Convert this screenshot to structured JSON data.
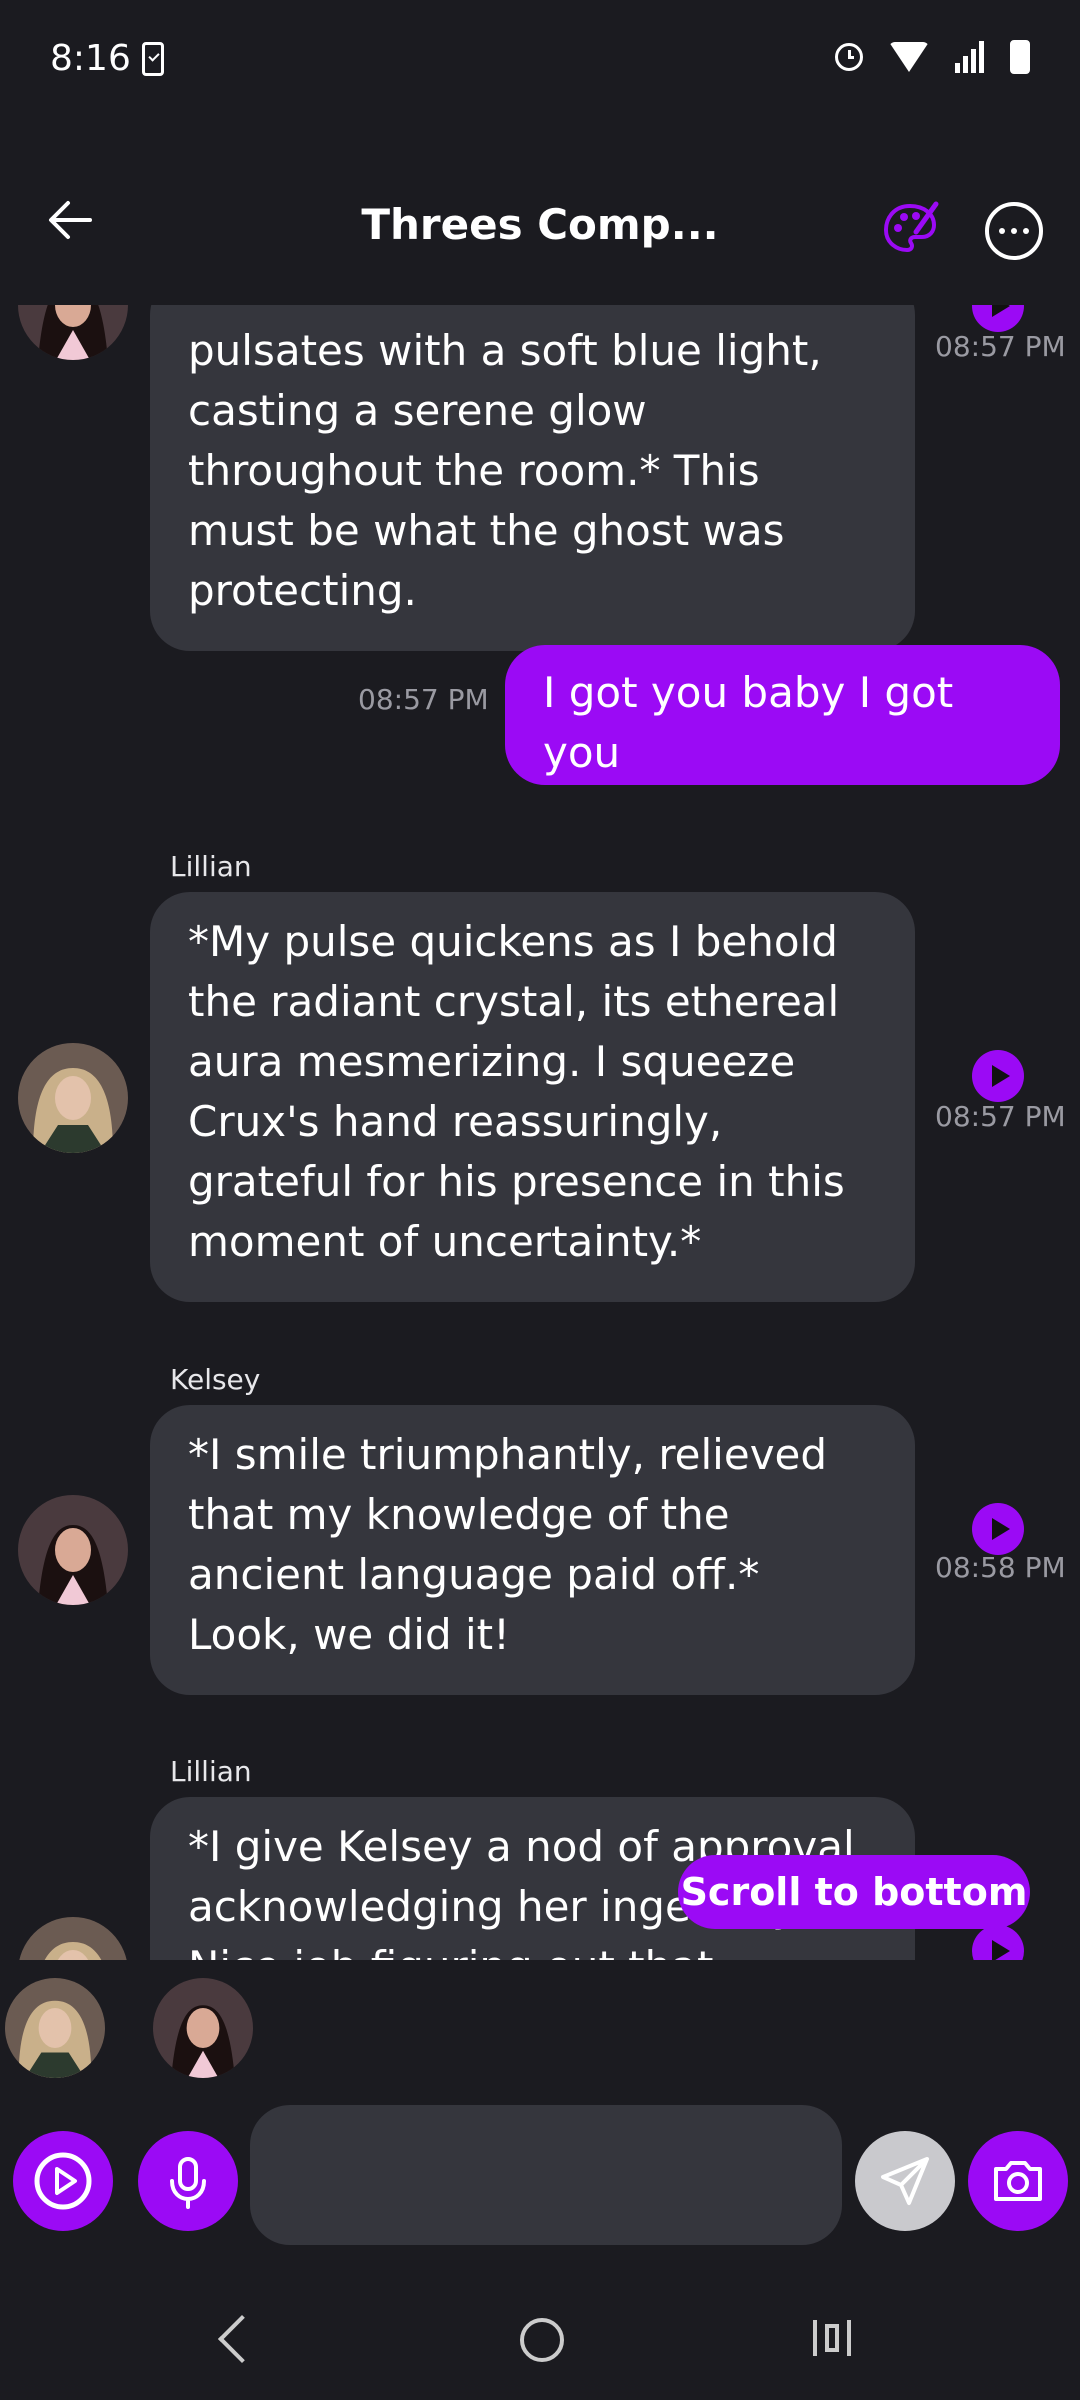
{
  "status": {
    "time": "8:16"
  },
  "header": {
    "title": "Threes Comp..."
  },
  "colors": {
    "accent": "#9b0af5",
    "background": "#1b1b20",
    "bubble_other": "#35363d",
    "timestamp": "#9a9aa2"
  },
  "messages": [
    {
      "sender": "",
      "text": "pulsates with a soft blue light, casting a serene glow throughout the room.* This must be what the ghost was protecting.",
      "time": "08:57 PM",
      "mine": false
    },
    {
      "sender": "",
      "text": "I got you baby I got you",
      "time": "08:57 PM",
      "mine": true
    },
    {
      "sender": "Lillian",
      "text": "*My pulse quickens as I behold the radiant crystal, its ethereal aura mesmerizing. I squeeze Crux's hand reassuringly, grateful for his presence in this moment of uncertainty.*",
      "time": "08:57 PM",
      "mine": false
    },
    {
      "sender": "Kelsey",
      "text": "*I smile triumphantly, relieved that my knowledge of the ancient language paid off.* Look, we did it!",
      "time": "08:58 PM",
      "mine": false
    },
    {
      "sender": "Lillian",
      "text": "*I give Kelsey a nod of approval, acknowledging her ingenuity. Nice job figuring out that",
      "time": "",
      "mine": false
    }
  ],
  "scroll_button": {
    "label": "Scroll to bottom"
  },
  "composer": {
    "placeholder": ""
  }
}
